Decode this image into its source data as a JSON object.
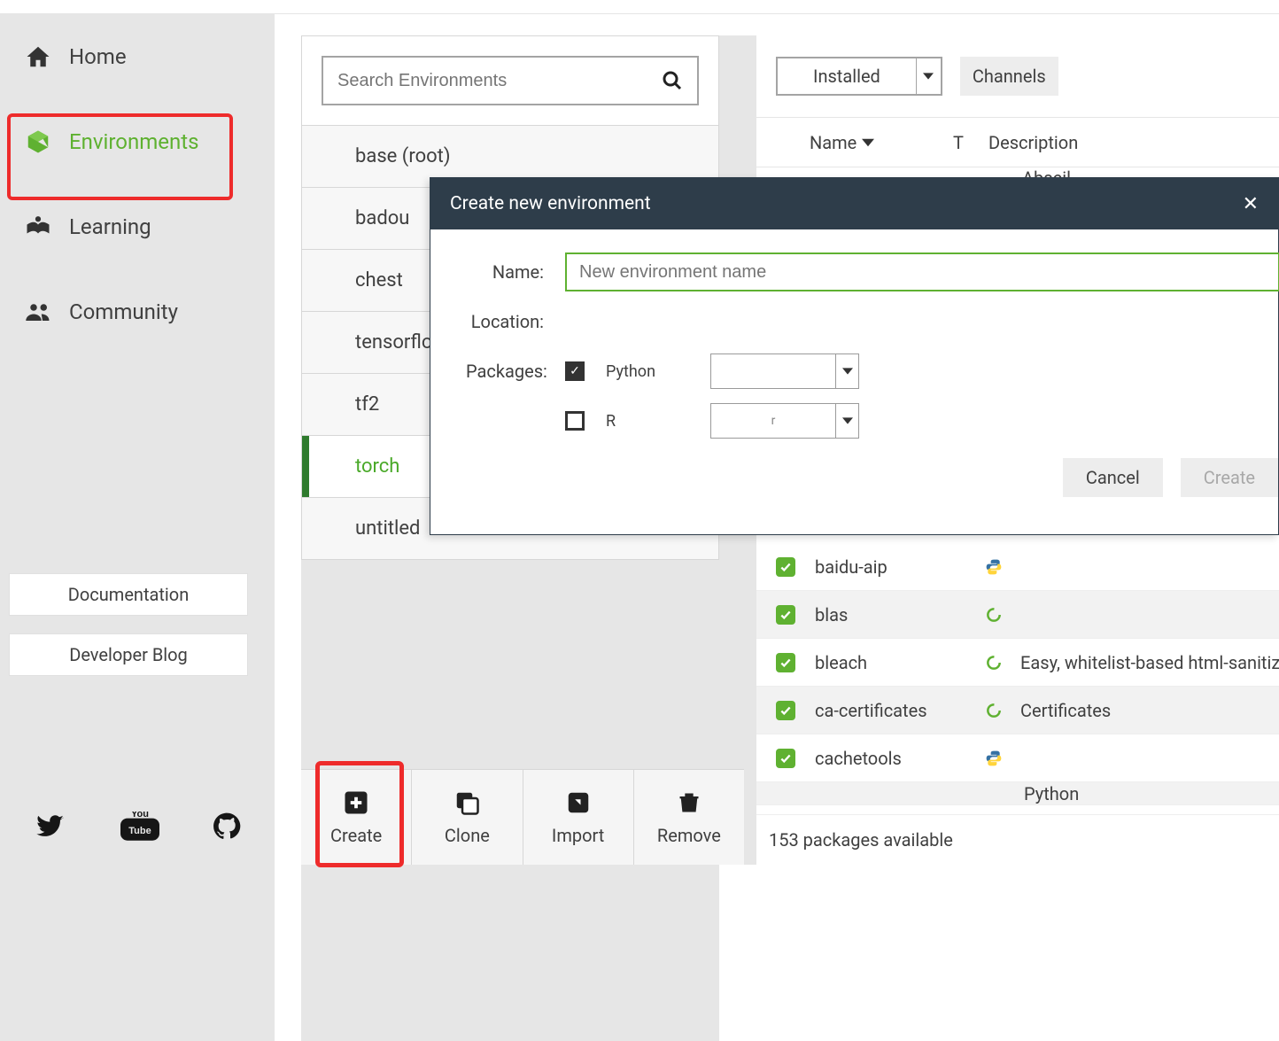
{
  "sidebar": {
    "items": [
      {
        "label": "Home"
      },
      {
        "label": "Environments"
      },
      {
        "label": "Learning"
      },
      {
        "label": "Community"
      }
    ],
    "buttons": {
      "documentation": "Documentation",
      "dev_blog": "Developer Blog"
    }
  },
  "search": {
    "placeholder": "Search Environments"
  },
  "environments": [
    {
      "name": "base (root)"
    },
    {
      "name": "badou"
    },
    {
      "name": "chest"
    },
    {
      "name": "tensorflow"
    },
    {
      "name": "tf2"
    },
    {
      "name": "torch",
      "active": true
    },
    {
      "name": "untitled"
    }
  ],
  "actions": {
    "create": "Create",
    "clone": "Clone",
    "import": "Import",
    "remove": "Remove"
  },
  "packages_panel": {
    "filter_selected": "Installed",
    "channels_button": "Channels",
    "columns": {
      "name": "Name",
      "t": "T",
      "desc": "Description"
    },
    "partial_top": "Abseil",
    "rows": [
      {
        "name": "baidu-aip",
        "type_icon": "python",
        "desc": ""
      },
      {
        "name": "blas",
        "type_icon": "o-green",
        "desc": ""
      },
      {
        "name": "bleach",
        "type_icon": "o-green",
        "desc": "Easy, whitelist-based html-sanitizing"
      },
      {
        "name": "ca-certificates",
        "type_icon": "o-green",
        "desc": "Certificates"
      },
      {
        "name": "cachetools",
        "type_icon": "python",
        "desc": ""
      }
    ],
    "partial_bottom": "Python",
    "footer": "153 packages available"
  },
  "dialog": {
    "title": "Create new environment",
    "labels": {
      "name": "Name:",
      "location": "Location:",
      "packages": "Packages:"
    },
    "name_placeholder": "New environment name",
    "python_label": "Python",
    "r_label": "R",
    "r_version": "r",
    "buttons": {
      "cancel": "Cancel",
      "create": "Create"
    }
  }
}
